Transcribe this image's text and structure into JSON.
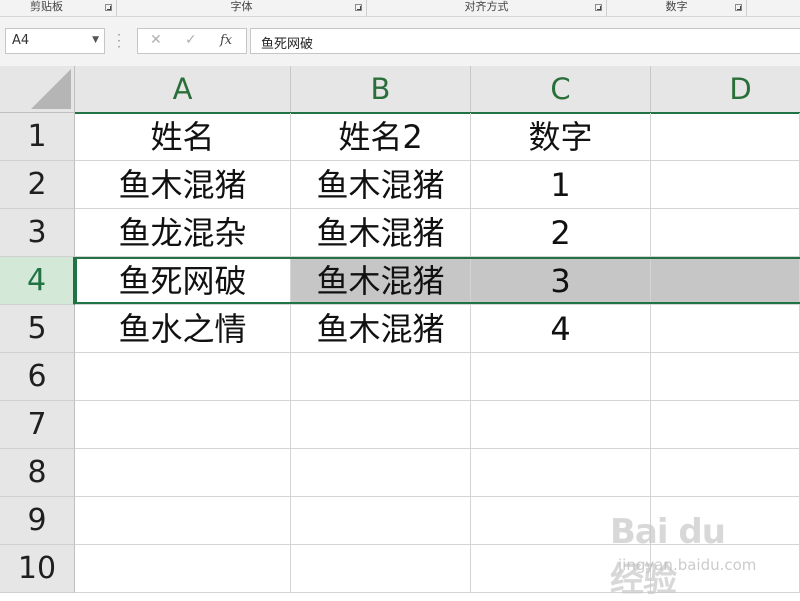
{
  "ribbon": {
    "groups": [
      {
        "label": "剪贴板"
      },
      {
        "label": "字体"
      },
      {
        "label": "对齐方式"
      },
      {
        "label": "数字"
      }
    ]
  },
  "formula_bar": {
    "name_box": "A4",
    "cancel_icon": "close-icon",
    "enter_icon": "check-icon",
    "fx_label": "fx",
    "formula_value": "鱼死网破"
  },
  "sheet": {
    "columns": [
      "A",
      "B",
      "C",
      "D"
    ],
    "rows": [
      "1",
      "2",
      "3",
      "4",
      "5",
      "6",
      "7",
      "8",
      "9",
      "10"
    ],
    "selected_row": "4",
    "cells": [
      [
        "姓名",
        "姓名2",
        "数字",
        ""
      ],
      [
        "鱼木混猪",
        "鱼木混猪",
        "1",
        ""
      ],
      [
        "鱼龙混杂",
        "鱼木混猪",
        "2",
        ""
      ],
      [
        "鱼死网破",
        "鱼木混猪",
        "3",
        ""
      ],
      [
        "鱼水之情",
        "鱼木混猪",
        "4",
        ""
      ],
      [
        "",
        "",
        "",
        ""
      ],
      [
        "",
        "",
        "",
        ""
      ],
      [
        "",
        "",
        "",
        ""
      ],
      [
        "",
        "",
        "",
        ""
      ],
      [
        "",
        "",
        "",
        ""
      ]
    ]
  },
  "watermark": {
    "main": "Bai du 经验",
    "sub": "jingyan.baidu.com"
  }
}
